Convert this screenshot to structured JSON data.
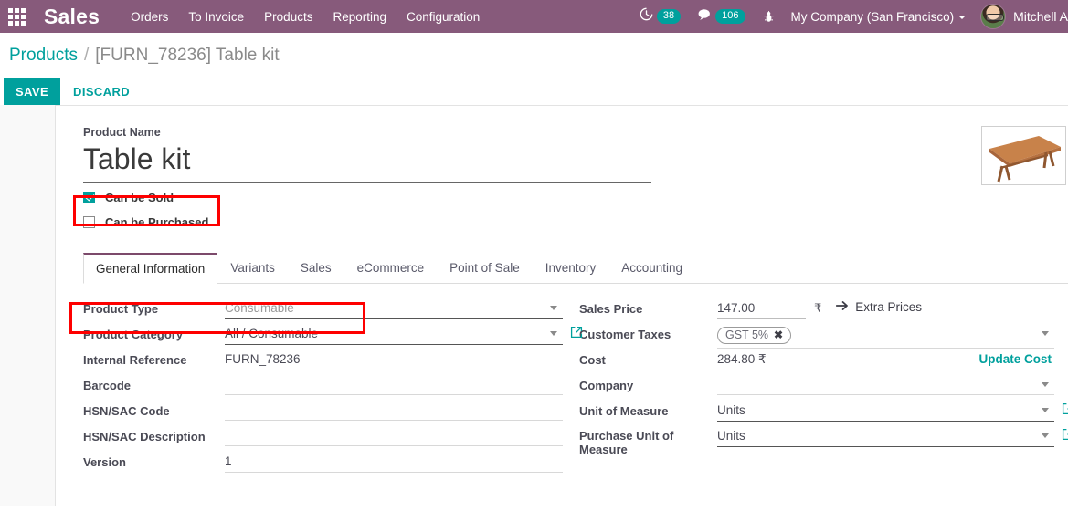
{
  "navbar": {
    "apps_icon": "apps-grid-icon",
    "brand": "Sales",
    "menu": [
      "Orders",
      "To Invoice",
      "Products",
      "Reporting",
      "Configuration"
    ],
    "activities": {
      "icon": "clock-icon",
      "count": "38"
    },
    "messages": {
      "icon": "chat-bubble-icon",
      "count": "106"
    },
    "debug": {
      "icon": "bug-icon"
    },
    "company": "My Company (San Francisco)",
    "user": "Mitchell A"
  },
  "control_panel": {
    "breadcrumb_root": "Products",
    "breadcrumb_sep": "/",
    "breadcrumb_current": "[FURN_78236] Table kit",
    "save_label": "SAVE",
    "discard_label": "DISCARD"
  },
  "form": {
    "product_name_label": "Product Name",
    "product_name_value": "Table kit",
    "can_be_sold_label": "Can be Sold",
    "can_be_sold_checked": true,
    "can_be_purchased_label": "Can be Purchased",
    "can_be_purchased_checked": false,
    "image_alt": "product-photo-wooden-table"
  },
  "tabs": [
    {
      "label": "General Information",
      "active": true
    },
    {
      "label": "Variants",
      "active": false
    },
    {
      "label": "Sales",
      "active": false
    },
    {
      "label": "eCommerce",
      "active": false
    },
    {
      "label": "Point of Sale",
      "active": false
    },
    {
      "label": "Inventory",
      "active": false
    },
    {
      "label": "Accounting",
      "active": false
    }
  ],
  "left_fields": {
    "product_type_label": "Product Type",
    "product_type_value": "Consumable",
    "product_category_label": "Product Category",
    "product_category_value": "All / Consumable",
    "internal_reference_label": "Internal Reference",
    "internal_reference_value": "FURN_78236",
    "barcode_label": "Barcode",
    "barcode_value": "",
    "hsn_code_label": "HSN/SAC Code",
    "hsn_code_value": "",
    "hsn_desc_label": "HSN/SAC Description",
    "hsn_desc_value": "",
    "version_label": "Version",
    "version_value": "1"
  },
  "right_fields": {
    "sales_price_label": "Sales Price",
    "sales_price_value": "147.00",
    "currency_symbol": "₹",
    "extra_prices_label": "Extra Prices",
    "customer_taxes_label": "Customer Taxes",
    "customer_tax_tag": "GST 5%",
    "tax_remove_icon": "✖",
    "cost_label": "Cost",
    "cost_value": "284.80 ₹",
    "update_cost_label": "Update Cost",
    "company_label": "Company",
    "company_value": "",
    "uom_label": "Unit of Measure",
    "uom_value": "Units",
    "purchase_uom_label": "Purchase Unit of Measure",
    "purchase_uom_value": "Units"
  },
  "colors": {
    "brand_purple": "#875a7b",
    "accent_teal": "#00a09d",
    "annotation_red": "#fe0000",
    "page_bg": "#f9f9f9"
  },
  "annotations": [
    {
      "name": "highlight-can-be-sold"
    },
    {
      "name": "highlight-product-type"
    }
  ]
}
